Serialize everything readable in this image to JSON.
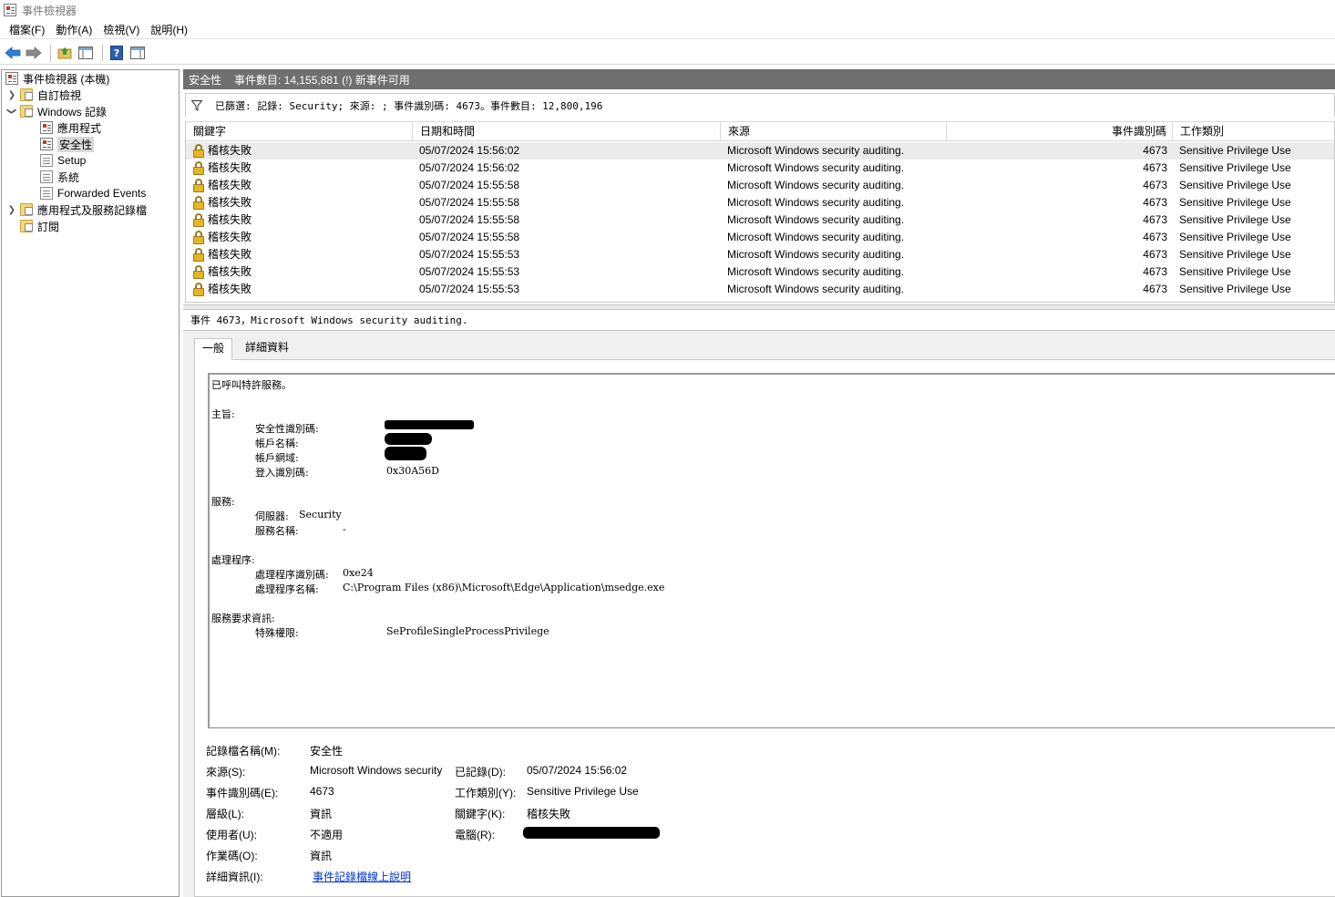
{
  "window": {
    "title": "事件檢視器"
  },
  "menu": [
    "檔案(F)",
    "動作(A)",
    "檢視(V)",
    "說明(H)"
  ],
  "toolbar": {
    "icons": [
      "back-arrow-icon",
      "forward-arrow-icon",
      "folder-up-icon",
      "show-hide-console-tree-icon",
      "help-icon",
      "properties-icon"
    ]
  },
  "tree": {
    "root": "事件檢視器 (本機)",
    "custom_views": "自訂檢視",
    "windows_logs": "Windows 記錄",
    "application": "應用程式",
    "security": "安全性",
    "setup": "Setup",
    "system": "系統",
    "forwarded": "Forwarded Events",
    "app_services": "應用程式及服務記錄檔",
    "subscriptions": "訂閱"
  },
  "log_header": {
    "name": "安全性",
    "info": "事件數目: 14,155,881 (!) 新事件可用"
  },
  "filter": {
    "text": "已篩選: 記錄: Security; 來源: ; 事件識別碼: 4673。事件數目: 12,800,196"
  },
  "table": {
    "columns": [
      "關鍵字",
      "日期和時間",
      "來源",
      "事件識別碼",
      "工作類別"
    ],
    "rows": [
      {
        "keyword": "稽核失敗",
        "datetime": "05/07/2024 15:56:02",
        "source": "Microsoft Windows security auditing.",
        "event_id": "4673",
        "task": "Sensitive Privilege Use"
      },
      {
        "keyword": "稽核失敗",
        "datetime": "05/07/2024 15:56:02",
        "source": "Microsoft Windows security auditing.",
        "event_id": "4673",
        "task": "Sensitive Privilege Use"
      },
      {
        "keyword": "稽核失敗",
        "datetime": "05/07/2024 15:55:58",
        "source": "Microsoft Windows security auditing.",
        "event_id": "4673",
        "task": "Sensitive Privilege Use"
      },
      {
        "keyword": "稽核失敗",
        "datetime": "05/07/2024 15:55:58",
        "source": "Microsoft Windows security auditing.",
        "event_id": "4673",
        "task": "Sensitive Privilege Use"
      },
      {
        "keyword": "稽核失敗",
        "datetime": "05/07/2024 15:55:58",
        "source": "Microsoft Windows security auditing.",
        "event_id": "4673",
        "task": "Sensitive Privilege Use"
      },
      {
        "keyword": "稽核失敗",
        "datetime": "05/07/2024 15:55:58",
        "source": "Microsoft Windows security auditing.",
        "event_id": "4673",
        "task": "Sensitive Privilege Use"
      },
      {
        "keyword": "稽核失敗",
        "datetime": "05/07/2024 15:55:53",
        "source": "Microsoft Windows security auditing.",
        "event_id": "4673",
        "task": "Sensitive Privilege Use"
      },
      {
        "keyword": "稽核失敗",
        "datetime": "05/07/2024 15:55:53",
        "source": "Microsoft Windows security auditing.",
        "event_id": "4673",
        "task": "Sensitive Privilege Use"
      },
      {
        "keyword": "稽核失敗",
        "datetime": "05/07/2024 15:55:53",
        "source": "Microsoft Windows security auditing.",
        "event_id": "4673",
        "task": "Sensitive Privilege Use"
      }
    ]
  },
  "detail": {
    "title": "事件 4673，Microsoft Windows security auditing.",
    "tabs": [
      "一般",
      "詳細資料"
    ],
    "description": {
      "intro": "已呼叫特許服務。",
      "subject_header": "主旨:",
      "security_id_label": "安全性識別碼:",
      "account_name_label": "帳戶名稱:",
      "account_domain_label": "帳戶網域:",
      "logon_id_label": "登入識別碼:",
      "logon_id": "0x30A56D",
      "service_header": "服務:",
      "server_label": "伺服器:",
      "server": "Security",
      "service_name_label": "服務名稱:",
      "service_name": "-",
      "process_header": "處理程序:",
      "process_id_label": "處理程序識別碼:",
      "process_id": "0xe24",
      "process_name_label": "處理程序名稱:",
      "process_name": "C:\\Program Files (x86)\\Microsoft\\Edge\\Application\\msedge.exe",
      "request_header": "服務要求資訊:",
      "privileges_label": "特殊權限:",
      "privileges": "SeProfileSingleProcessPrivilege"
    },
    "props": {
      "log_name_label": "記錄檔名稱(M):",
      "log_name": "安全性",
      "source_label": "來源(S):",
      "source": "Microsoft Windows security",
      "logged_label": "已記錄(D):",
      "logged": "05/07/2024 15:56:02",
      "event_id_label": "事件識別碼(E):",
      "event_id": "4673",
      "task_label": "工作類別(Y):",
      "task": "Sensitive Privilege Use",
      "level_label": "層級(L):",
      "level": "資訊",
      "keywords_label": "關鍵字(K):",
      "keywords": "稽核失敗",
      "user_label": "使用者(U):",
      "user": "不適用",
      "computer_label": "電腦(R):",
      "opcode_label": "作業碼(O):",
      "opcode": "資訊",
      "more_info_label": "詳細資訊(I):",
      "more_info_link": "事件記錄檔線上說明"
    }
  }
}
